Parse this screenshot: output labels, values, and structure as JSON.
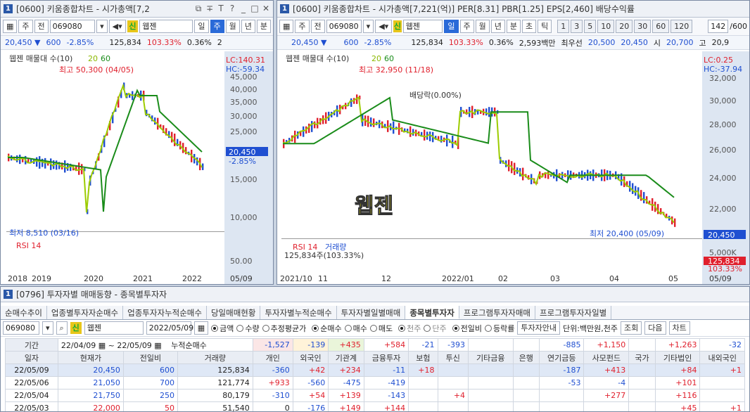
{
  "left": {
    "num": "1",
    "title": "[0600] 키움종합차트 - 시가총액[7,2",
    "period_buttons": [
      "주",
      "전"
    ],
    "code": "069080",
    "shin": "신",
    "name": "웹젠",
    "tabs": [
      "일",
      "주",
      "월",
      "년",
      "분"
    ],
    "active_tab": "주",
    "quote": {
      "price": "20,450",
      "change": "600",
      "rate": "-2.85%",
      "volume": "125,834",
      "vol_ratio": "103.33%",
      "turnover": "0.36%",
      "extra": "2"
    },
    "legend": "웹젠 매물대 수(10)",
    "ma": [
      "20",
      "60"
    ],
    "high_label": "최고 50,300 (04/05)",
    "low_label": "최저 8,510 (03/16)",
    "lc": "LC:140.31",
    "hc": "HC:-59.34",
    "yticks": [
      "45,000",
      "40,000",
      "35,000",
      "30,000",
      "25,000",
      "15,000",
      "10,000"
    ],
    "price_tag": "20,450",
    "rate_tag": "-2.85%",
    "rsi": "RSI 14",
    "rsi_tick": "50.00",
    "xticks": [
      "2018",
      "2019",
      "2020",
      "2021",
      "2022"
    ],
    "date": "05/09"
  },
  "right": {
    "num": "1",
    "title": "[0600] 키움종합차트 - 시가총액[7,221(억)] PER[8.31] PBR[1.25] EPS[2,460] 배당수익률",
    "code": "069080",
    "shin": "신",
    "name": "웹젠",
    "tabs": [
      "일",
      "주",
      "월",
      "년",
      "분",
      "초",
      "틱"
    ],
    "active_tab": "일",
    "nums": [
      "1",
      "3",
      "5",
      "10",
      "20",
      "30",
      "60",
      "120"
    ],
    "count": "142",
    "total": "/600",
    "quote": {
      "price": "20,450",
      "change": "600",
      "rate": "-2.85%",
      "volume": "125,834",
      "vol_ratio": "103.33%",
      "turnover": "0.36%",
      "amount": "2,593백만",
      "pref_label": "최우선",
      "bid": "20,500",
      "ask": "20,450",
      "open_label": "시",
      "open": "20,700",
      "high_label": "고",
      "high": "20,9"
    },
    "legend": "웹젠 매물대 수(10)",
    "ma": [
      "20",
      "60"
    ],
    "high_label": "최고 32,950 (11/18)",
    "low_label": "최저 20,400 (05/09)",
    "dividend": "배당락(0.00%)",
    "watermark": "웹젠",
    "lc": "LC:0.25",
    "hc": "HC:-37.94",
    "yticks": [
      "32,000",
      "30,000",
      "28,000",
      "26,000",
      "24,000",
      "22,000"
    ],
    "price_tag": "20,450",
    "rsi": "RSI 14",
    "vol_label": "거래량",
    "vol_text": "125,834주(103.33%)",
    "vol_tick": "5,000K",
    "vol_tag": "125,834",
    "vol_rate": "103.33%",
    "xticks": [
      "2021/10",
      "11",
      "12",
      "2022/01",
      "02",
      "03",
      "04",
      "05"
    ],
    "date": "05/09"
  },
  "bottom": {
    "num": "1",
    "title": "[0796] 투자자별 매매동향 - 종목별투자자",
    "tabs": [
      "순매수추이",
      "업종별투자자순매수",
      "업종투자자누적순매수",
      "당일매매현황",
      "투자자별누적순매수",
      "투자자별일별매매",
      "종목별투자자",
      "프로그램투자자매매",
      "프로그램투자자일별"
    ],
    "active_tab": "종목별투자자",
    "code": "069080",
    "shin": "신",
    "name": "웹젠",
    "date": "2022/05/09",
    "radio1": [
      "금액",
      "수량",
      "추정평균가"
    ],
    "radio2": [
      "순매수",
      "매수",
      "매도"
    ],
    "radio3": [
      "천주",
      "단주"
    ],
    "radio4": [
      "전일비",
      "등락률"
    ],
    "invest_btn": "투자자안내",
    "unit": "단위:백만원,천주",
    "btn_query": "조회",
    "btn_next": "다음",
    "btn_chart": "차트",
    "period_label": "기간",
    "from": "22/04/09",
    "to": "22/05/09",
    "cum_label": "누적순매수",
    "cum": [
      "-1,527",
      "-139",
      "+435",
      "+584",
      "-21",
      "-393",
      "",
      "",
      "-885",
      "+1,150",
      "",
      "+1,263",
      "-32"
    ],
    "headers": [
      "일자",
      "현재가",
      "전일비",
      "거래량",
      "개인",
      "외국인",
      "기관계",
      "금융투자",
      "보험",
      "투신",
      "기타금융",
      "은행",
      "연기금등",
      "사모펀드",
      "국가",
      "기타법인",
      "내외국인"
    ],
    "rows": [
      [
        "22/05/09",
        "20,450",
        "600",
        "125,834",
        "-360",
        "+42",
        "+234",
        "-11",
        "+18",
        "",
        "",
        "",
        "-187",
        "+413",
        "",
        "+84",
        "+1"
      ],
      [
        "22/05/06",
        "21,050",
        "700",
        "121,774",
        "+933",
        "-560",
        "-475",
        "-419",
        "",
        "",
        "",
        "",
        "-53",
        "-4",
        "",
        "+101",
        ""
      ],
      [
        "22/05/04",
        "21,750",
        "250",
        "80,179",
        "-310",
        "+54",
        "+139",
        "-143",
        "",
        "+4",
        "",
        "",
        "",
        "+277",
        "",
        "+116",
        ""
      ],
      [
        "22/05/03",
        "22,000",
        "50",
        "51,540",
        "0",
        "-176",
        "+149",
        "+144",
        "",
        "",
        "",
        "",
        "",
        "",
        "",
        "+45",
        "+1"
      ]
    ]
  }
}
